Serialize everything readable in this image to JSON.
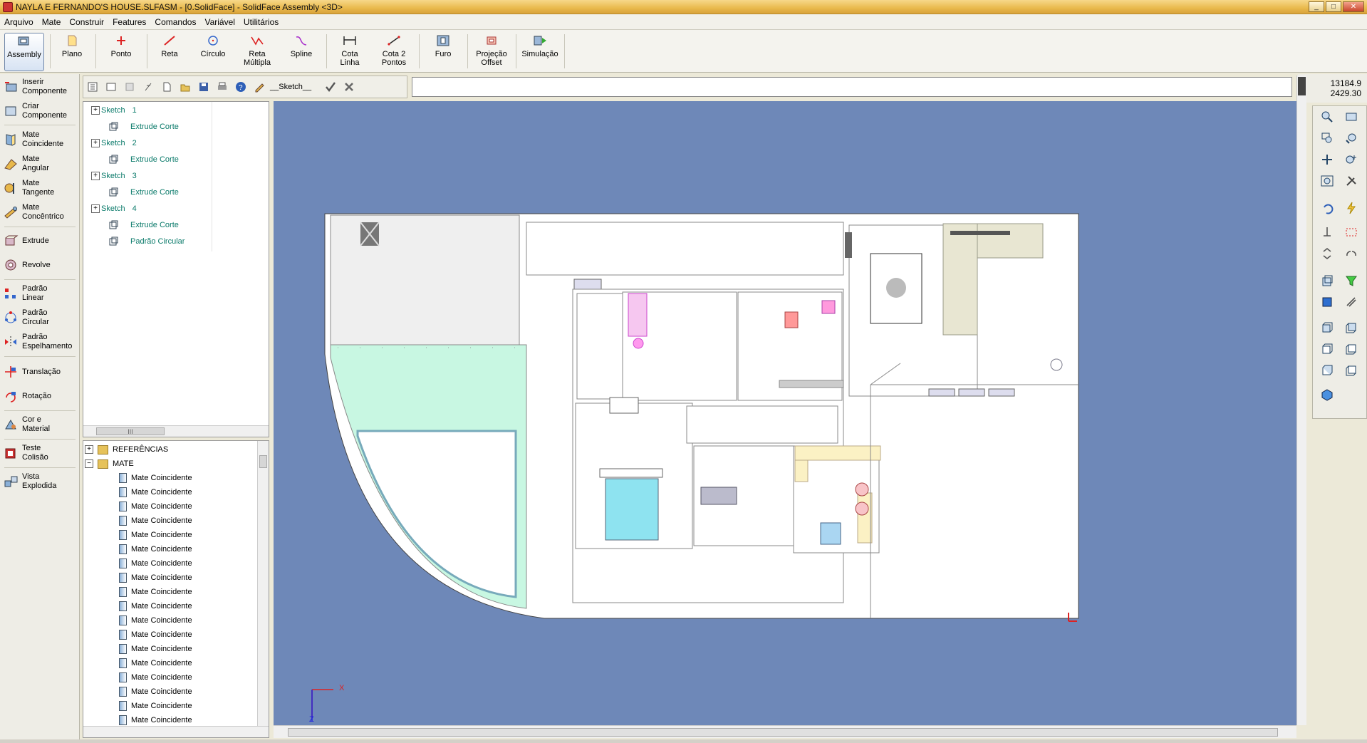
{
  "window": {
    "title": "NAYLA E FERNANDO'S HOUSE.SLFASM - [0.SolidFace] - SolidFace Assembly <3D>",
    "min": "_",
    "max": "□",
    "close": "✕"
  },
  "menu": [
    "Arquivo",
    "Mate",
    "Construir",
    "Features",
    "Comandos",
    "Variável",
    "Utilitários"
  ],
  "ribbon": {
    "assembly": "Assembly",
    "plano": "Plano",
    "ponto": "Ponto",
    "reta": "Reta",
    "circulo": "Círculo",
    "reta_multipla_1": "Reta",
    "reta_multipla_2": "Múltipla",
    "spline": "Spline",
    "cota_linha_1": "Cota",
    "cota_linha_2": "Linha",
    "cota2_1": "Cota 2",
    "cota2_2": "Pontos",
    "furo": "Furo",
    "projecao_1": "Projeção",
    "projecao_2": "Offset",
    "simulacao": "Simulação"
  },
  "left": {
    "inserir_1": "Inserir",
    "inserir_2": "Componente",
    "criar_1": "Criar",
    "criar_2": "Componente",
    "mate_coinc_1": "Mate",
    "mate_coinc_2": "Coincidente",
    "mate_ang_1": "Mate",
    "mate_ang_2": "Angular",
    "mate_tang_1": "Mate",
    "mate_tang_2": "Tangente",
    "mate_conc_1": "Mate",
    "mate_conc_2": "Concêntrico",
    "extrude": "Extrude",
    "revolve": "Revolve",
    "plin_1": "Padrão",
    "plin_2": "Linear",
    "pcirc_1": "Padrão",
    "pcirc_2": "Circular",
    "pesp_1": "Padrão",
    "pesp_2": "Espelhamento",
    "translacao": "Translação",
    "rotacao": "Rotação",
    "cor_1": "Cor e",
    "cor_2": "Material",
    "teste_1": "Teste",
    "teste_2": "Colisão",
    "vista_1": "Vista",
    "vista_2": "Explodida"
  },
  "toolstrip": {
    "sketch_label": "__Sketch__"
  },
  "coords": {
    "x": "13184.9",
    "y": "2429.30"
  },
  "tree": {
    "rows": [
      {
        "kind": "sketch",
        "label": "Sketch",
        "num": "1"
      },
      {
        "kind": "feat",
        "label": "Extrude Corte"
      },
      {
        "kind": "sketch",
        "label": "Sketch",
        "num": "2"
      },
      {
        "kind": "feat",
        "label": "Extrude Corte"
      },
      {
        "kind": "sketch",
        "label": "Sketch",
        "num": "3"
      },
      {
        "kind": "feat",
        "label": "Extrude Corte"
      },
      {
        "kind": "sketch",
        "label": "Sketch",
        "num": "4"
      },
      {
        "kind": "feat",
        "label": "Extrude Corte"
      },
      {
        "kind": "feat",
        "label": "Padrão Circular"
      }
    ],
    "scroll_label": "III"
  },
  "mates": {
    "referencias": "REFERÊNCIAS",
    "mate": "MATE",
    "item": "Mate Coincidente",
    "count": 18,
    "expand_plus": "+",
    "expand_minus": "−"
  },
  "viewport": {
    "axis_x": "X",
    "axis_z": "Z"
  },
  "colors": {
    "viewport_bg": "#6e88b8",
    "garden": "#c8f7e2",
    "tree_text": "#0a7a6a"
  }
}
